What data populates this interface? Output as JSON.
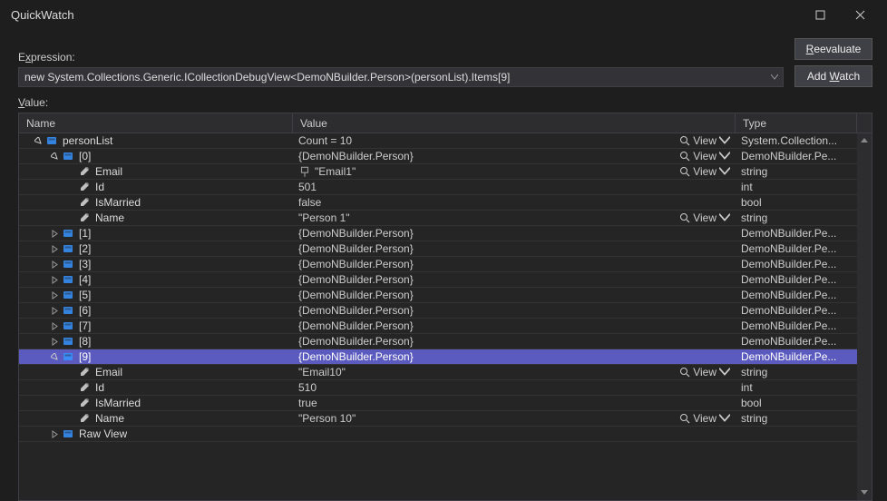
{
  "window": {
    "title": "QuickWatch"
  },
  "expression": {
    "label_pre": "E",
    "label_ul": "x",
    "label_post": "pression:",
    "value": "new System.Collections.Generic.ICollectionDebugView<DemoNBuilder.Person>(personList).Items[9]"
  },
  "buttons": {
    "reevaluate_ul": "R",
    "reevaluate_post": "eevaluate",
    "addwatch_pre": "Add ",
    "addwatch_ul": "W",
    "addwatch_post": "atch"
  },
  "value_label": {
    "ul": "V",
    "post": "alue:"
  },
  "columns": {
    "name": "Name",
    "value": "Value",
    "type": "Type"
  },
  "view_label": "View",
  "rows": [
    {
      "indent": 0,
      "tw": "open",
      "ic": "obj",
      "name": "personList",
      "value": "Count = 10",
      "view": true,
      "type": "System.Collection..."
    },
    {
      "indent": 1,
      "tw": "open",
      "ic": "obj",
      "name": "[0]",
      "value": "{DemoNBuilder.Person}",
      "view": true,
      "type": "DemoNBuilder.Pe..."
    },
    {
      "indent": 2,
      "tw": "",
      "ic": "prop",
      "name": "Email",
      "value": "\"Email1\"",
      "pin": true,
      "view": true,
      "type": "string"
    },
    {
      "indent": 2,
      "tw": "",
      "ic": "prop",
      "name": "Id",
      "value": "501",
      "type": "int"
    },
    {
      "indent": 2,
      "tw": "",
      "ic": "prop",
      "name": "IsMarried",
      "value": "false",
      "type": "bool"
    },
    {
      "indent": 2,
      "tw": "",
      "ic": "prop",
      "name": "Name",
      "value": "\"Person 1\"",
      "view": true,
      "type": "string"
    },
    {
      "indent": 1,
      "tw": "closed",
      "ic": "obj",
      "name": "[1]",
      "value": "{DemoNBuilder.Person}",
      "type": "DemoNBuilder.Pe..."
    },
    {
      "indent": 1,
      "tw": "closed",
      "ic": "obj",
      "name": "[2]",
      "value": "{DemoNBuilder.Person}",
      "type": "DemoNBuilder.Pe..."
    },
    {
      "indent": 1,
      "tw": "closed",
      "ic": "obj",
      "name": "[3]",
      "value": "{DemoNBuilder.Person}",
      "type": "DemoNBuilder.Pe..."
    },
    {
      "indent": 1,
      "tw": "closed",
      "ic": "obj",
      "name": "[4]",
      "value": "{DemoNBuilder.Person}",
      "type": "DemoNBuilder.Pe..."
    },
    {
      "indent": 1,
      "tw": "closed",
      "ic": "obj",
      "name": "[5]",
      "value": "{DemoNBuilder.Person}",
      "type": "DemoNBuilder.Pe..."
    },
    {
      "indent": 1,
      "tw": "closed",
      "ic": "obj",
      "name": "[6]",
      "value": "{DemoNBuilder.Person}",
      "type": "DemoNBuilder.Pe..."
    },
    {
      "indent": 1,
      "tw": "closed",
      "ic": "obj",
      "name": "[7]",
      "value": "{DemoNBuilder.Person}",
      "type": "DemoNBuilder.Pe..."
    },
    {
      "indent": 1,
      "tw": "closed",
      "ic": "obj",
      "name": "[8]",
      "value": "{DemoNBuilder.Person}",
      "type": "DemoNBuilder.Pe..."
    },
    {
      "indent": 1,
      "tw": "open",
      "ic": "obj",
      "name": "[9]",
      "value": "{DemoNBuilder.Person}",
      "sel": true,
      "type": "DemoNBuilder.Pe..."
    },
    {
      "indent": 2,
      "tw": "",
      "ic": "prop",
      "name": "Email",
      "value": "\"Email10\"",
      "view": true,
      "type": "string"
    },
    {
      "indent": 2,
      "tw": "",
      "ic": "prop",
      "name": "Id",
      "value": "510",
      "type": "int"
    },
    {
      "indent": 2,
      "tw": "",
      "ic": "prop",
      "name": "IsMarried",
      "value": "true",
      "type": "bool"
    },
    {
      "indent": 2,
      "tw": "",
      "ic": "prop",
      "name": "Name",
      "value": "\"Person 10\"",
      "view": true,
      "type": "string"
    },
    {
      "indent": 1,
      "tw": "closed",
      "ic": "obj",
      "name": "Raw View",
      "value": "",
      "type": ""
    }
  ]
}
